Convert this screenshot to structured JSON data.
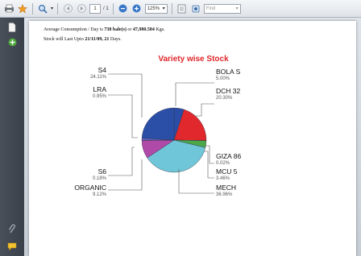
{
  "toolbar": {
    "page_number": "1",
    "zoom": "125%",
    "find_placeholder": "Find"
  },
  "report": {
    "line1_prefix": "Average Consumption / Day is ",
    "line1_bales": "738 bale(s)",
    "line1_mid": " or ",
    "line1_kgs": "47,980.584",
    "line1_suffix": " Kgs.",
    "line2_prefix": "Stock will Last Upto ",
    "line2_date": "21/11/09, 21",
    "line2_suffix": " Days."
  },
  "chart_data": {
    "type": "pie",
    "title": "Variety wise Stock",
    "slices": [
      {
        "label": "BOLA S",
        "value": 5.0,
        "pct_text": "5.00%",
        "color": "#2a4ea8"
      },
      {
        "label": "DCH 32",
        "value": 20.3,
        "pct_text": "20.30%",
        "color": "#e0282d"
      },
      {
        "label": "GIZA 86",
        "value": 0.02,
        "pct_text": "0.02%",
        "color": "#c8c8c8"
      },
      {
        "label": "MCU 5",
        "value": 3.46,
        "pct_text": "3.46%",
        "color": "#4ba84a"
      },
      {
        "label": "MECH",
        "value": 36.96,
        "pct_text": "36.96%",
        "color": "#6fc6d8"
      },
      {
        "label": "ORGANIC",
        "value": 9.12,
        "pct_text": "9.12%",
        "color": "#b04aa8"
      },
      {
        "label": "S6",
        "value": 0.18,
        "pct_text": "0.18%",
        "color": "#e8d840"
      },
      {
        "label": "LRA",
        "value": 0.95,
        "pct_text": "0.95%",
        "color": "#6a6ad0"
      },
      {
        "label": "S4",
        "value": 24.11,
        "pct_text": "24.11%",
        "color": "#2b4ea6"
      }
    ]
  }
}
